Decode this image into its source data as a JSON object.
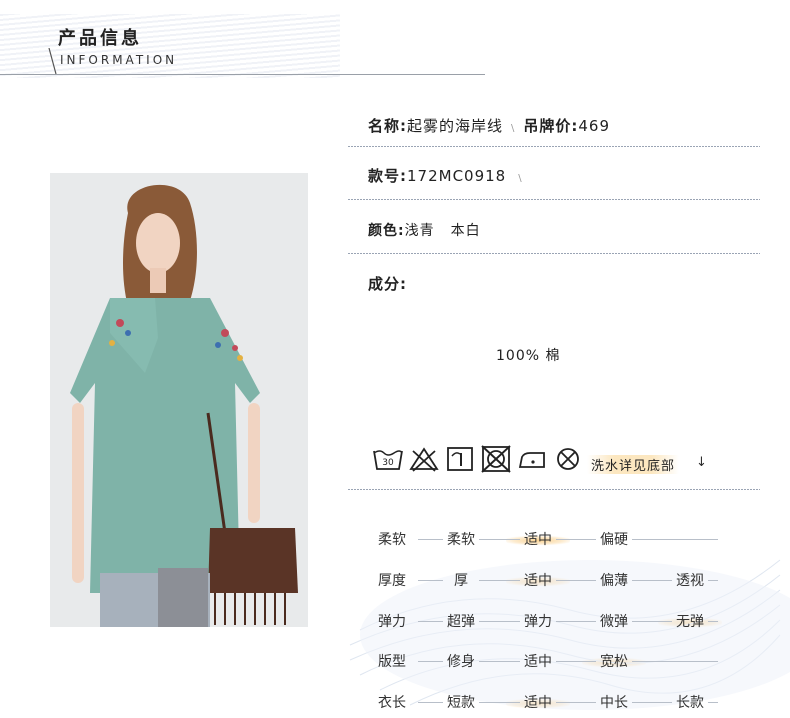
{
  "header": {
    "title": "产品信息",
    "subtitle": "INFORMATION"
  },
  "product": {
    "name_label": "名称:",
    "name_value": "起雾的海岸线",
    "price_label": "吊牌价:",
    "price_value": "469",
    "code_label": "款号:",
    "code_value": "172MC0918",
    "color_label": "颜色:",
    "colors": [
      "浅青",
      "本白"
    ],
    "composition_label": "成分:",
    "composition_value": "100% 棉"
  },
  "care": {
    "icons": [
      "wash-30-icon",
      "no-bleach-icon",
      "tumble-dry-icon",
      "no-dryclean-icon",
      "iron-low-icon",
      "no-wring-icon"
    ],
    "wash_temp": "30",
    "note": "洗水详见底部",
    "arrow": "↓"
  },
  "attributes": [
    {
      "label": "柔软",
      "options": [
        "柔软",
        "适中",
        "偏硬"
      ],
      "selected": 1
    },
    {
      "label": "厚度",
      "options": [
        "厚",
        "适中",
        "偏薄",
        "透视"
      ],
      "selected": 1
    },
    {
      "label": "弹力",
      "options": [
        "超弹",
        "弹力",
        "微弹",
        "无弹"
      ],
      "selected": 3
    },
    {
      "label": "版型",
      "options": [
        "修身",
        "适中",
        "宽松"
      ],
      "selected": 2
    },
    {
      "label": "衣长",
      "options": [
        "短款",
        "适中",
        "中长",
        "长款"
      ],
      "selected": 1
    }
  ],
  "colors": {
    "accent_highlight": "#f9c878",
    "rule": "#9aa4b4",
    "blouse": "#7fb3a8"
  }
}
